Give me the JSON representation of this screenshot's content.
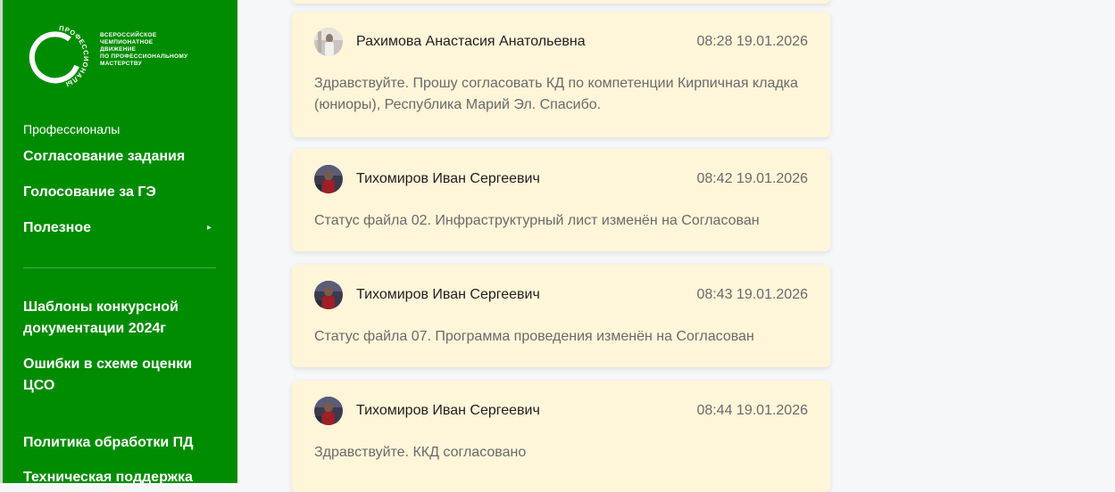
{
  "sidebar": {
    "logo": {
      "ring_text": "ПРОФЕССИОНАЛЫ",
      "lines": [
        "ВСЕРОССИЙСКОЕ",
        "ЧЕМПИОНАТНОЕ",
        "ДВИЖЕНИЕ",
        "ПО ПРОФЕССИОНАЛЬНОМУ",
        "МАСТЕРСТВУ"
      ]
    },
    "section_label": "Профессионалы",
    "items": [
      {
        "label": "Согласование задания"
      },
      {
        "label": "Голосование за ГЭ"
      },
      {
        "label": "Полезное",
        "icon": "chevron-right-icon"
      }
    ],
    "links": [
      {
        "label": "Шаблоны конкурсной документации 2024г"
      },
      {
        "label": "Ошибки в схеме оценки ЦСО"
      },
      {
        "label": "Политика обработки ПД"
      },
      {
        "label": "Техническая поддержка"
      }
    ]
  },
  "messages": [
    {
      "author": "Рахимова Анастасия Анатольевна",
      "time": "08:28 19.01.2026",
      "text": "Здравствуйте. Прошу согласовать КД по компетенции Кирпичная кладка (юниоры), Республика Марий Эл. Спасибо.",
      "avatar": "light"
    },
    {
      "author": "Тихомиров Иван Сергеевич",
      "time": "08:42 19.01.2026",
      "text": "Статус файла 02. Инфраструктурный лист изменён на Согласован",
      "avatar": "dark"
    },
    {
      "author": "Тихомиров Иван Сергеевич",
      "time": "08:43 19.01.2026",
      "text": "Статус файла 07. Программа проведения изменён на Согласован",
      "avatar": "dark"
    },
    {
      "author": "Тихомиров Иван Сергеевич",
      "time": "08:44 19.01.2026",
      "text": "Здравствуйте. ККД согласовано",
      "avatar": "dark"
    }
  ],
  "colors": {
    "sidebar_bg": "#008c00",
    "card_bg": "#fff5d9",
    "page_bg": "#f6f7f9"
  }
}
